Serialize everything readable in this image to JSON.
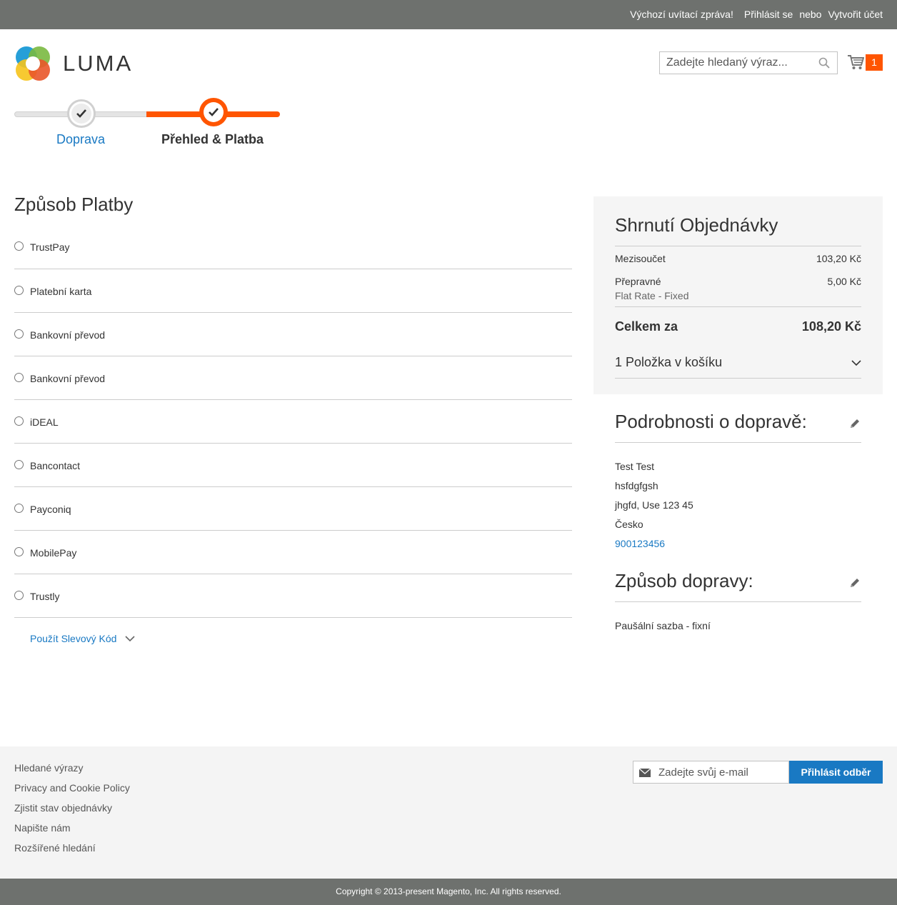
{
  "topbar": {
    "welcome": "Výchozí uvítací zpráva!",
    "signin": "Přihlásit se",
    "or": "nebo",
    "create_account": "Vytvořit účet"
  },
  "header": {
    "logo_text": "LUMA",
    "search_placeholder": "Zadejte hledaný výraz...",
    "cart_count": "1"
  },
  "progress": {
    "steps": [
      {
        "label": "Doprava"
      },
      {
        "label": "Přehled & Platba"
      }
    ],
    "accent": "#ff5501"
  },
  "payment": {
    "title": "Způsob Platby",
    "methods": [
      "TrustPay",
      "Platební karta",
      "Bankovní převod",
      "Bankovní převod",
      "iDEAL",
      "Bancontact",
      "Payconiq",
      "MobilePay",
      "Trustly"
    ],
    "discount_label": "Použít Slevový Kód"
  },
  "summary": {
    "title": "Shrnutí Objednávky",
    "subtotal_label": "Mezisoučet",
    "subtotal_value": "103,20 Kč",
    "shipping_label": "Přepravné",
    "shipping_value": "5,00 Kč",
    "shipping_method": "Flat Rate - Fixed",
    "total_label": "Celkem za",
    "total_value": "108,20 Kč",
    "items_label": "1 Položka v košíku"
  },
  "shipping_info": {
    "title": "Podrobnosti o dopravě:",
    "name": "Test Test",
    "street": "hsfdgfgsh",
    "city": "jhgfd, Use 123 45",
    "country": "Česko",
    "phone": "900123456",
    "method_title": "Způsob dopravy:",
    "method": "Paušální sazba - fixní"
  },
  "footer": {
    "links": [
      "Hledané výrazy",
      "Privacy and Cookie Policy",
      "Zjistit stav objednávky",
      "Napište nám",
      "Rozšířené hledání"
    ],
    "newsletter_placeholder": "Zadejte svůj e-mail",
    "newsletter_button": "Přihlásit odběr",
    "copyright": "Copyright © 2013-present Magento, Inc. All rights reserved."
  },
  "colors": {
    "link": "#1979c3",
    "accent": "#ff5501",
    "topbar": "#6e716e"
  }
}
